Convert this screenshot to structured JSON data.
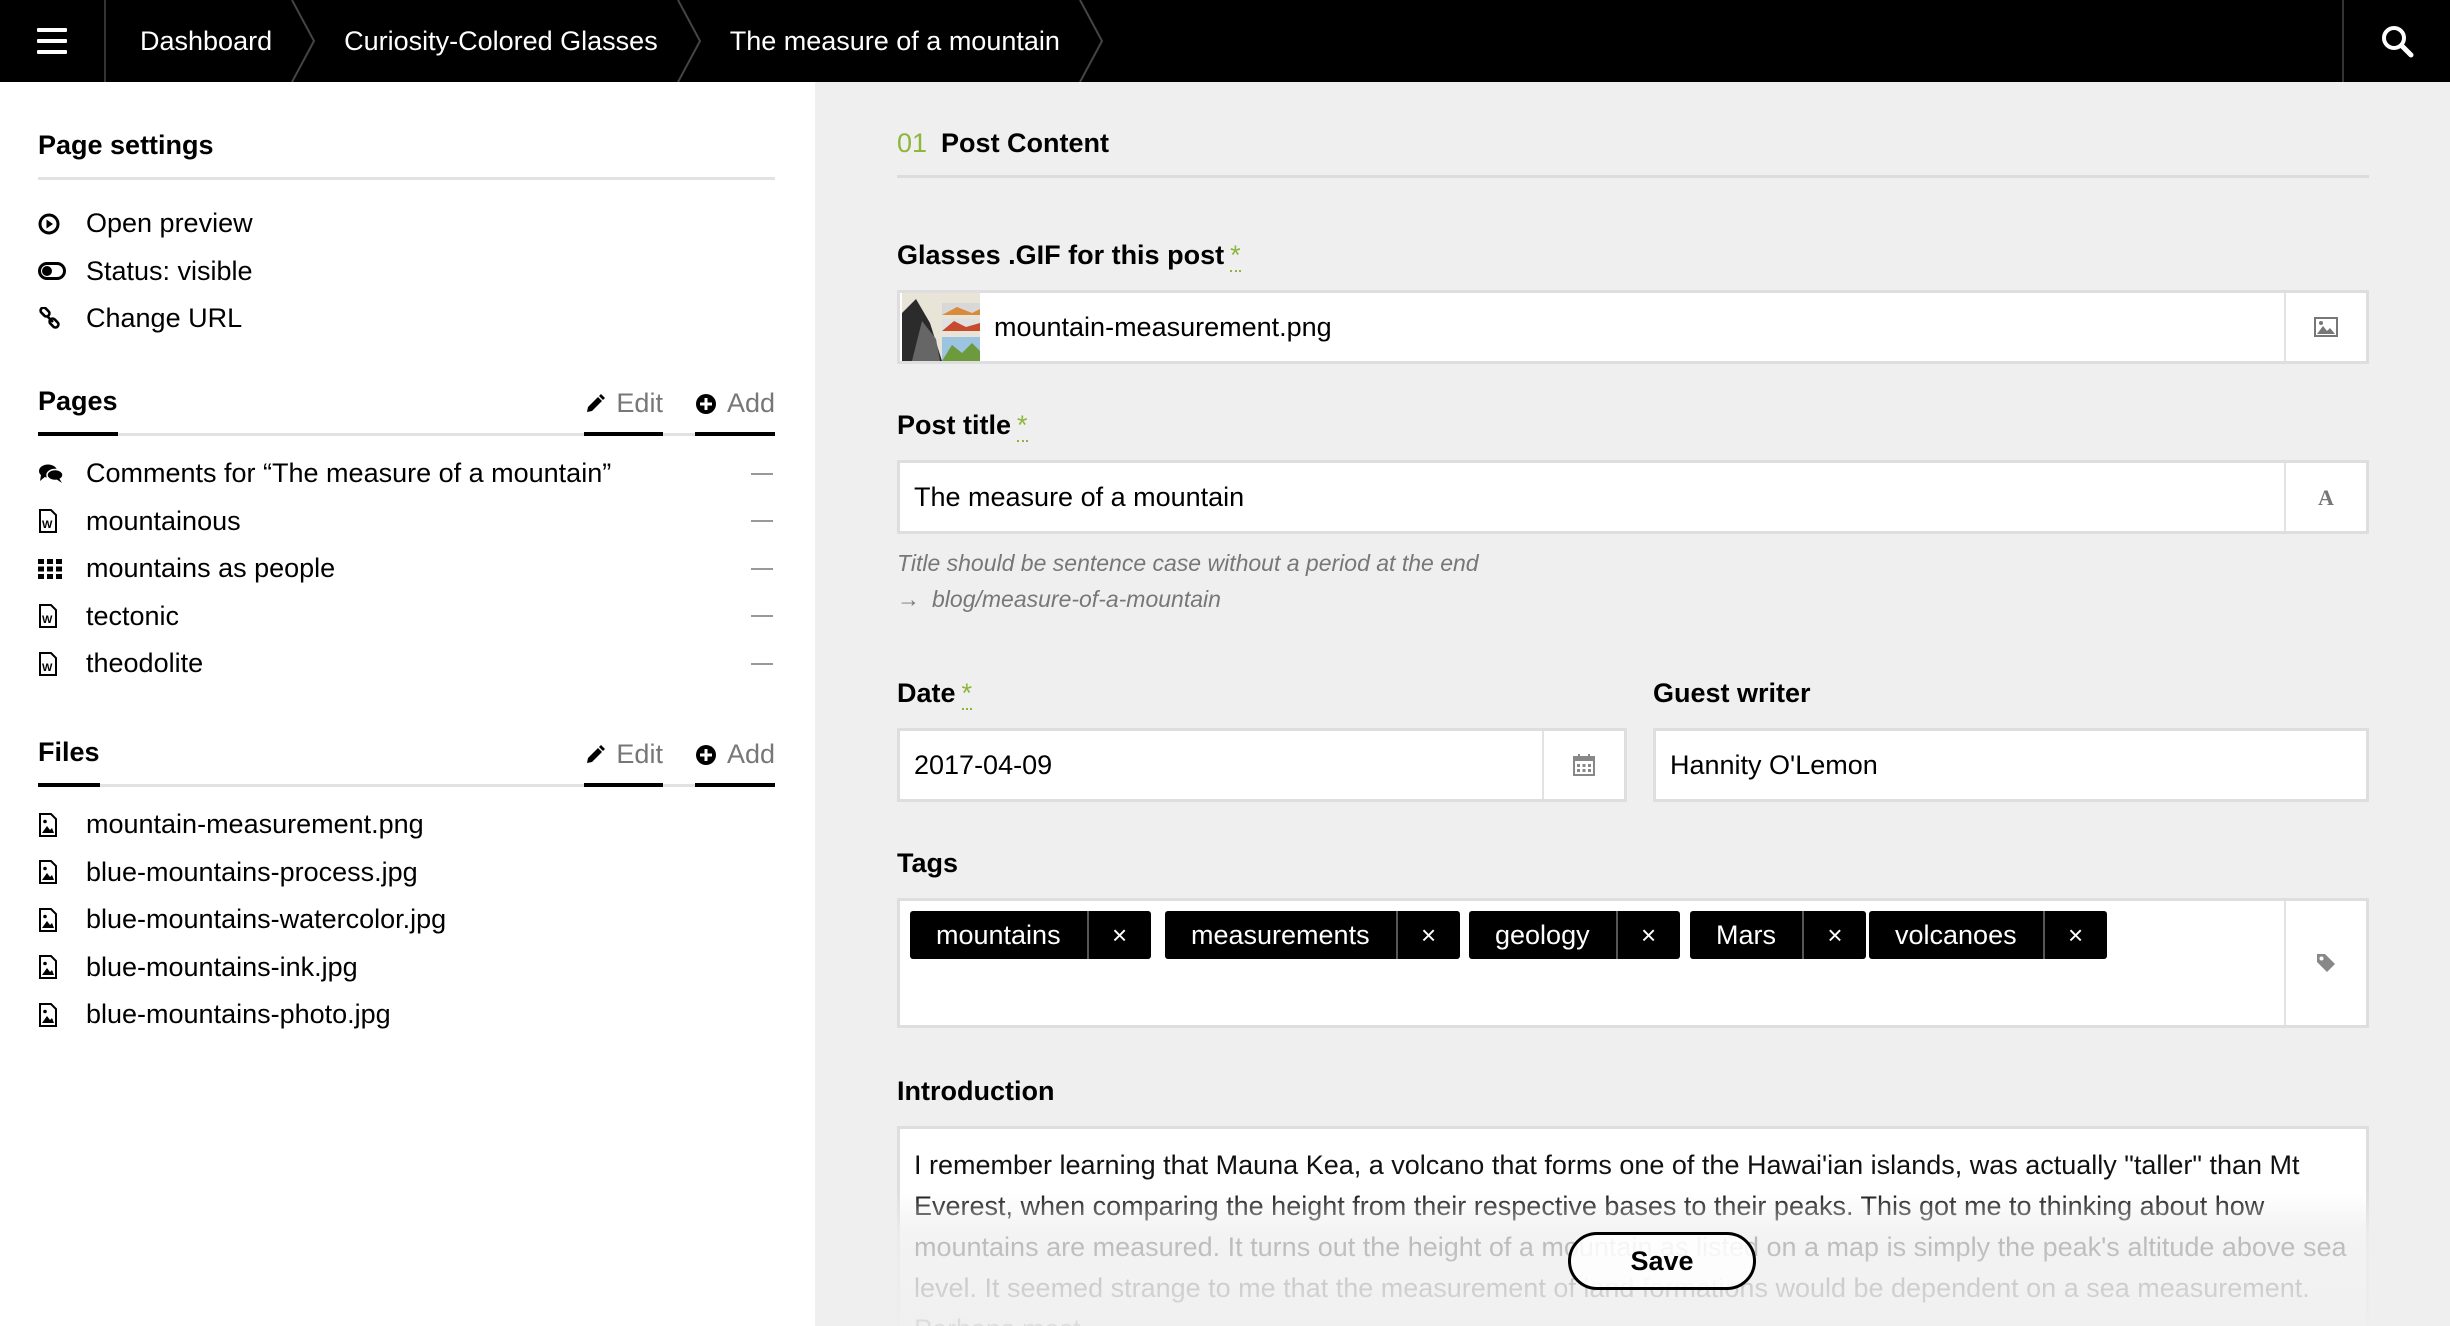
{
  "topbar": {
    "breadcrumbs": [
      "Dashboard",
      "Curiosity-Colored Glasses",
      "The measure of a mountain"
    ]
  },
  "sidebar": {
    "page_settings": {
      "title": "Page settings",
      "items": [
        {
          "label": "Open preview",
          "icon": "play-circle-icon"
        },
        {
          "label": "Status: visible",
          "icon": "toggle-icon"
        },
        {
          "label": "Change URL",
          "icon": "chain-link-icon"
        }
      ]
    },
    "pages": {
      "title": "Pages",
      "edit_label": "Edit",
      "add_label": "Add",
      "items": [
        {
          "label": "Comments for “The measure of a mountain”",
          "icon": "comments-icon"
        },
        {
          "label": "mountainous",
          "icon": "word-doc-icon"
        },
        {
          "label": "mountains as people",
          "icon": "grid-icon"
        },
        {
          "label": "tectonic",
          "icon": "word-doc-icon"
        },
        {
          "label": "theodolite",
          "icon": "word-doc-icon"
        }
      ]
    },
    "files": {
      "title": "Files",
      "edit_label": "Edit",
      "add_label": "Add",
      "items": [
        {
          "label": "mountain-measurement.png",
          "icon": "image-file-icon"
        },
        {
          "label": "blue-mountains-process.jpg",
          "icon": "image-file-icon"
        },
        {
          "label": "blue-mountains-watercolor.jpg",
          "icon": "image-file-icon"
        },
        {
          "label": "blue-mountains-ink.jpg",
          "icon": "image-file-icon"
        },
        {
          "label": "blue-mountains-photo.jpg",
          "icon": "image-file-icon"
        }
      ]
    }
  },
  "main": {
    "section_number": "01",
    "section_title": "Post Content",
    "gif_field": {
      "label": "Glasses .GIF for this post",
      "required": "*",
      "value": "mountain-measurement.png"
    },
    "title_field": {
      "label": "Post title",
      "required": "*",
      "value": "The measure of a mountain",
      "help": "Title should be sentence case without a period at the end",
      "slug": "blog/measure-of-a-mountain",
      "slug_arrow": "→"
    },
    "date_field": {
      "label": "Date",
      "required": "*",
      "value": "2017-04-09"
    },
    "guest_field": {
      "label": "Guest writer",
      "value": "Hannity O'Lemon"
    },
    "tags_field": {
      "label": "Tags",
      "remove_symbol": "×",
      "tags": [
        "mountains",
        "measurements",
        "geology",
        "Mars",
        "volcanoes"
      ]
    },
    "intro_field": {
      "label": "Introduction",
      "value": "I remember learning that Mauna Kea, a volcano that forms one of the  Hawai'ian islands, was actually \"taller\" than Mt Everest, when comparing the height from their respective bases to their peaks. This got me to thinking about how mountains are measured. It turns out the height of a mountain as listed on a map is simply the peak's altitude above sea level. It seemed strange to me that the measurement of land formations would be dependent on a sea measurement. Perhaps most"
    },
    "save_label": "Save"
  },
  "colors": {
    "accent": "#8db63c",
    "topbar": "#000000",
    "main_bg": "#efefef"
  }
}
